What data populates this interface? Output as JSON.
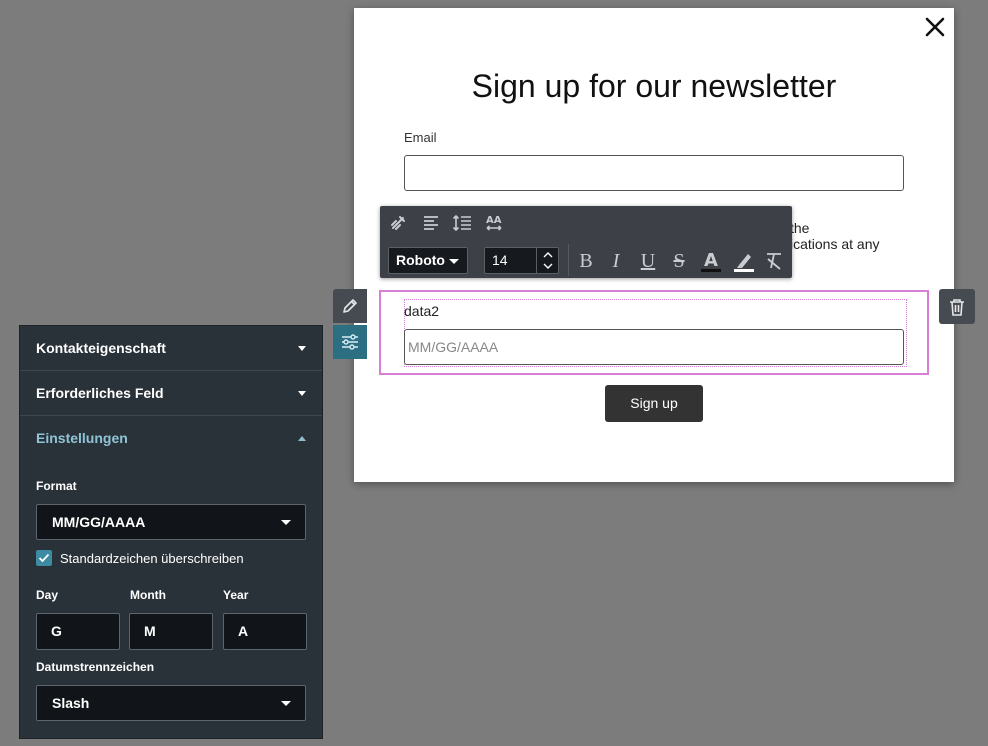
{
  "modal": {
    "title": "Sign up for our newsletter",
    "email_label": "Email",
    "consent_text_line1": "the",
    "consent_text_line2": "ications at any",
    "date_label": "data2",
    "date_placeholder": "MM/GG/AAAA",
    "signup_label": "Sign up"
  },
  "toolbar": {
    "font": "Roboto",
    "size": "14",
    "icons": [
      "unlink-icon",
      "align-left-icon",
      "line-height-icon",
      "letter-spacing-icon"
    ],
    "format_buttons": [
      "bold",
      "italic",
      "underline",
      "strikethrough",
      "text-color",
      "highlight",
      "clear-format"
    ]
  },
  "panel": {
    "sections": [
      {
        "label": "Kontakteigenschaft",
        "expanded": false
      },
      {
        "label": "Erforderliches Feld",
        "expanded": false
      },
      {
        "label": "Einstellungen",
        "expanded": true
      }
    ],
    "format_label": "Format",
    "format_value": "MM/GG/AAAA",
    "override_label": "Standardzeichen überschreiben",
    "override_checked": true,
    "day_label": "Day",
    "day_value": "G",
    "month_label": "Month",
    "month_value": "M",
    "year_label": "Year",
    "year_value": "A",
    "separator_label": "Datumstrennzeichen",
    "separator_value": "Slash"
  },
  "colors": {
    "background": "#7c7c7c",
    "panel": "#2a3239",
    "accent": "#3d8aa3",
    "selection": "#d77fd6",
    "toolbar": "#3d4147"
  }
}
